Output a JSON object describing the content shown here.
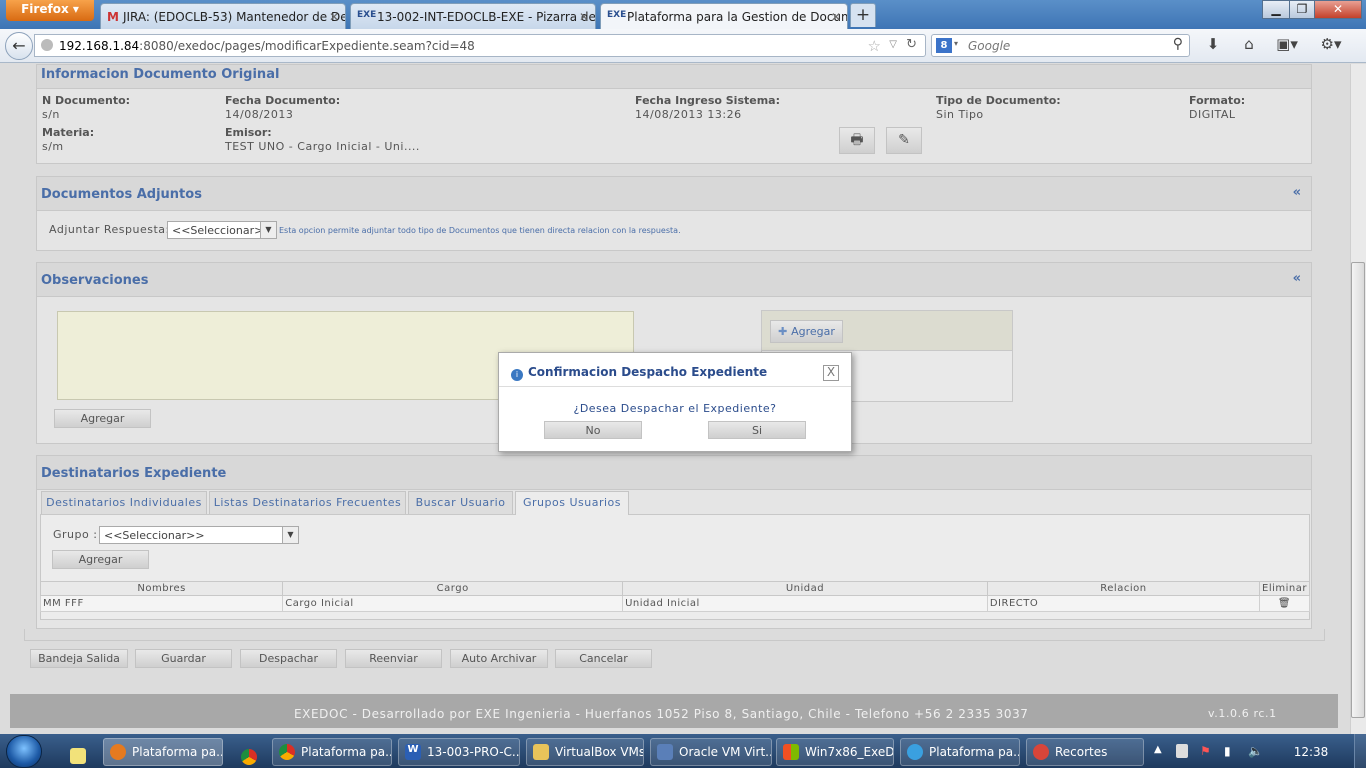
{
  "browser": {
    "menu_label": "Firefox",
    "tabs": [
      {
        "label": "JIRA: (EDOCLB-53) Mantenedor de De...",
        "icon": "gmail-icon"
      },
      {
        "label": "13-002-INT-EDOCLB-EXE - Pizarra de ...",
        "icon": "exe-icon"
      },
      {
        "label": "Plataforma para la Gestion de Docum...",
        "icon": "exe-icon"
      }
    ],
    "url_host": "192.168.1.84",
    "url_path": ":8080/exedoc/pages/modificarExpediente.seam?cid=48",
    "search_placeholder": "Google"
  },
  "original": {
    "title": "Informacion Documento Original",
    "n_documento_label": "N Documento:",
    "n_documento": "s/n",
    "fecha_doc_label": "Fecha Documento:",
    "fecha_doc": "14/08/2013",
    "fecha_ingreso_label": "Fecha Ingreso Sistema:",
    "fecha_ingreso": "14/08/2013 13:26",
    "tipo_label": "Tipo de Documento:",
    "tipo": "Sin Tipo",
    "formato_label": "Formato:",
    "formato": "DIGITAL",
    "materia_label": "Materia:",
    "materia": "s/m",
    "emisor_label": "Emisor:",
    "emisor": "TEST UNO - Cargo Inicial - Uni...."
  },
  "adjuntos": {
    "title": "Documentos Adjuntos",
    "collapse": "«",
    "label": "Adjuntar Respuesta:",
    "select_value": "<<Seleccionar>>",
    "hint": "Esta opcion permite adjuntar todo tipo de Documentos que tienen directa relacion con la respuesta."
  },
  "observaciones": {
    "title": "Observaciones",
    "collapse": "«",
    "add_button": "Agregar",
    "add_button_right": "Agregar"
  },
  "dialog": {
    "title": "Confirmacion Despacho Expediente",
    "question": "¿Desea Despachar el Expediente?",
    "no": "No",
    "si": "Si",
    "close": "X"
  },
  "destinatarios": {
    "title": "Destinatarios Expediente",
    "tabs": [
      "Destinatarios Individuales",
      "Listas Destinatarios Frecuentes",
      "Buscar Usuario",
      "Grupos Usuarios"
    ],
    "grupo_label": "Grupo :",
    "grupo_value": "<<Seleccionar>>",
    "add_button": "Agregar",
    "columns": [
      "Nombres",
      "Cargo",
      "Unidad",
      "Relacion",
      "Eliminar"
    ],
    "rows": [
      {
        "nombres": "MM FFF",
        "cargo": "Cargo Inicial",
        "unidad": "Unidad Inicial",
        "relacion": "DIRECTO"
      }
    ]
  },
  "actions": [
    "Bandeja Salida",
    "Guardar",
    "Despachar",
    "Reenviar",
    "Auto Archivar",
    "Cancelar"
  ],
  "footer": {
    "text": "EXEDOC - Desarrollado por EXE Ingenieria - Huerfanos 1052 Piso 8, Santiago, Chile - Telefono +56 2 2335 3037",
    "version": "v.1.0.6 rc.1"
  },
  "taskbar": {
    "items": [
      {
        "label": "Plataforma pa...",
        "icon": "firefox-icon"
      },
      {
        "label": "Plataforma pa...",
        "icon": "chrome-icon"
      },
      {
        "label": "13-003-PRO-C...",
        "icon": "word-icon"
      },
      {
        "label": "VirtualBox VMs",
        "icon": "folder-icon"
      },
      {
        "label": "Oracle VM Virt...",
        "icon": "virtualbox-icon"
      },
      {
        "label": "Win7x86_ExeD...",
        "icon": "vm-icon"
      },
      {
        "label": "Plataforma pa...",
        "icon": "ie-icon"
      },
      {
        "label": "Recortes",
        "icon": "scissors-icon"
      }
    ],
    "clock": "12:38"
  }
}
